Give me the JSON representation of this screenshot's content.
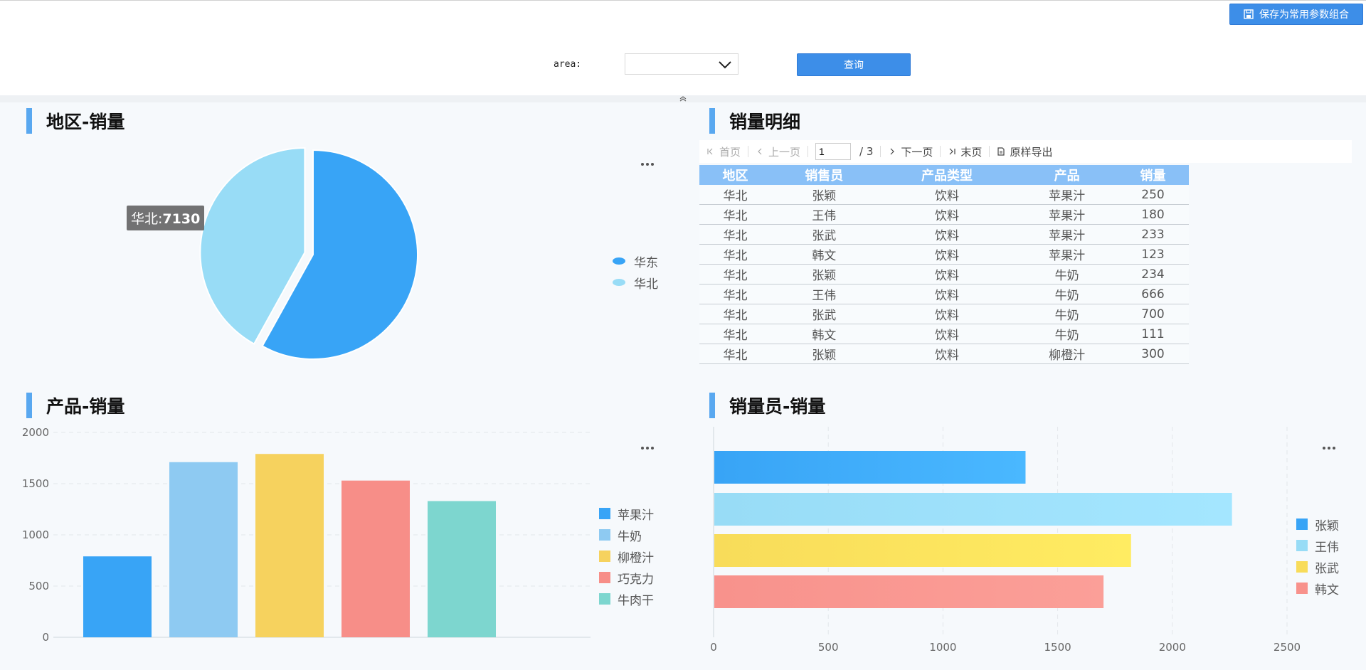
{
  "toolbar": {
    "save_label": "保存为常用参数组合",
    "query_label": "查询",
    "area_label": "area:",
    "area_value": ""
  },
  "panels": {
    "region_sales": {
      "title": "地区-销量"
    },
    "sales_detail": {
      "title": "销量明细"
    },
    "product_sales": {
      "title": "产品-销量"
    },
    "seller_sales": {
      "title": "销量员-销量"
    }
  },
  "tooltip": {
    "label": "华北:",
    "value": "7130"
  },
  "pager": {
    "first": "首页",
    "prev": "上一页",
    "current": "1",
    "total": "/ 3",
    "next": "下一页",
    "last": "末页",
    "export": "原样导出"
  },
  "table": {
    "headers": [
      "地区",
      "销售员",
      "产品类型",
      "产品",
      "销量"
    ],
    "rows": [
      [
        "华北",
        "张颖",
        "饮料",
        "苹果汁",
        "250"
      ],
      [
        "华北",
        "王伟",
        "饮料",
        "苹果汁",
        "180"
      ],
      [
        "华北",
        "张武",
        "饮料",
        "苹果汁",
        "233"
      ],
      [
        "华北",
        "韩文",
        "饮料",
        "苹果汁",
        "123"
      ],
      [
        "华北",
        "张颖",
        "饮料",
        "牛奶",
        "234"
      ],
      [
        "华北",
        "王伟",
        "饮料",
        "牛奶",
        "666"
      ],
      [
        "华北",
        "张武",
        "饮料",
        "牛奶",
        "700"
      ],
      [
        "华北",
        "韩文",
        "饮料",
        "牛奶",
        "111"
      ],
      [
        "华北",
        "张颖",
        "饮料",
        "柳橙汁",
        "300"
      ]
    ]
  },
  "colors": {
    "accent": "#3d8ee8",
    "header": "#89c0f7"
  },
  "chart_data": [
    {
      "type": "pie",
      "categories": [
        "华东",
        "华北"
      ],
      "values": [
        9870,
        7130
      ],
      "colors": [
        "#38a4f6",
        "#98dcf6"
      ],
      "legend": "right"
    },
    {
      "type": "bar",
      "categories": [
        "苹果汁",
        "牛奶",
        "柳橙汁",
        "巧克力",
        "牛肉干"
      ],
      "values": [
        790,
        1710,
        1790,
        1530,
        1330
      ],
      "colors": [
        "#38a4f6",
        "#8ecaf2",
        "#f6d25e",
        "#f78e88",
        "#7dd6cf"
      ],
      "ylim": [
        0,
        2000
      ],
      "yticks": [
        0,
        500,
        1000,
        1500,
        2000
      ],
      "legend": "right"
    },
    {
      "type": "bar",
      "orientation": "horizontal",
      "categories": [
        "张颖",
        "王伟",
        "张武",
        "韩文"
      ],
      "values": [
        1360,
        2260,
        1820,
        1700
      ],
      "colors": [
        "#38a4f6",
        "#98dcf6",
        "#f8dc5a",
        "#f8928c"
      ],
      "xlim": [
        0,
        2500
      ],
      "xticks": [
        0,
        500,
        1000,
        1500,
        2000,
        2500
      ],
      "legend": "right"
    }
  ]
}
